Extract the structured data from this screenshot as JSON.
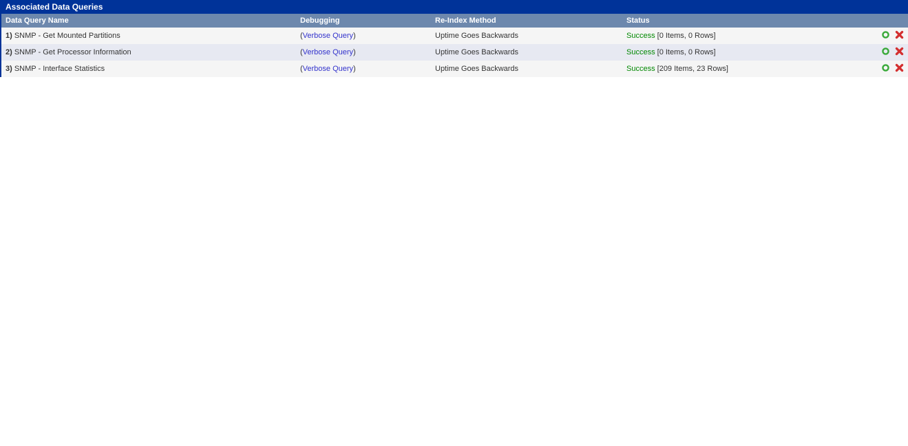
{
  "panel": {
    "title": "Associated Data Queries"
  },
  "columns": {
    "name": "Data Query Name",
    "debugging": "Debugging",
    "reindex": "Re-Index Method",
    "status": "Status"
  },
  "rows": [
    {
      "num": "1)",
      "name": "SNMP - Get Mounted Partitions",
      "debug_link": "Verbose Query",
      "reindex": "Uptime Goes Backwards",
      "status_word": "Success",
      "status_detail": "[0 Items, 0 Rows]"
    },
    {
      "num": "2)",
      "name": "SNMP - Get Processor Information",
      "debug_link": "Verbose Query",
      "reindex": "Uptime Goes Backwards",
      "status_word": "Success",
      "status_detail": "[0 Items, 0 Rows]"
    },
    {
      "num": "3)",
      "name": "SNMP - Interface Statistics",
      "debug_link": "Verbose Query",
      "reindex": "Uptime Goes Backwards",
      "status_word": "Success",
      "status_detail": "[209 Items, 23 Rows]"
    }
  ]
}
